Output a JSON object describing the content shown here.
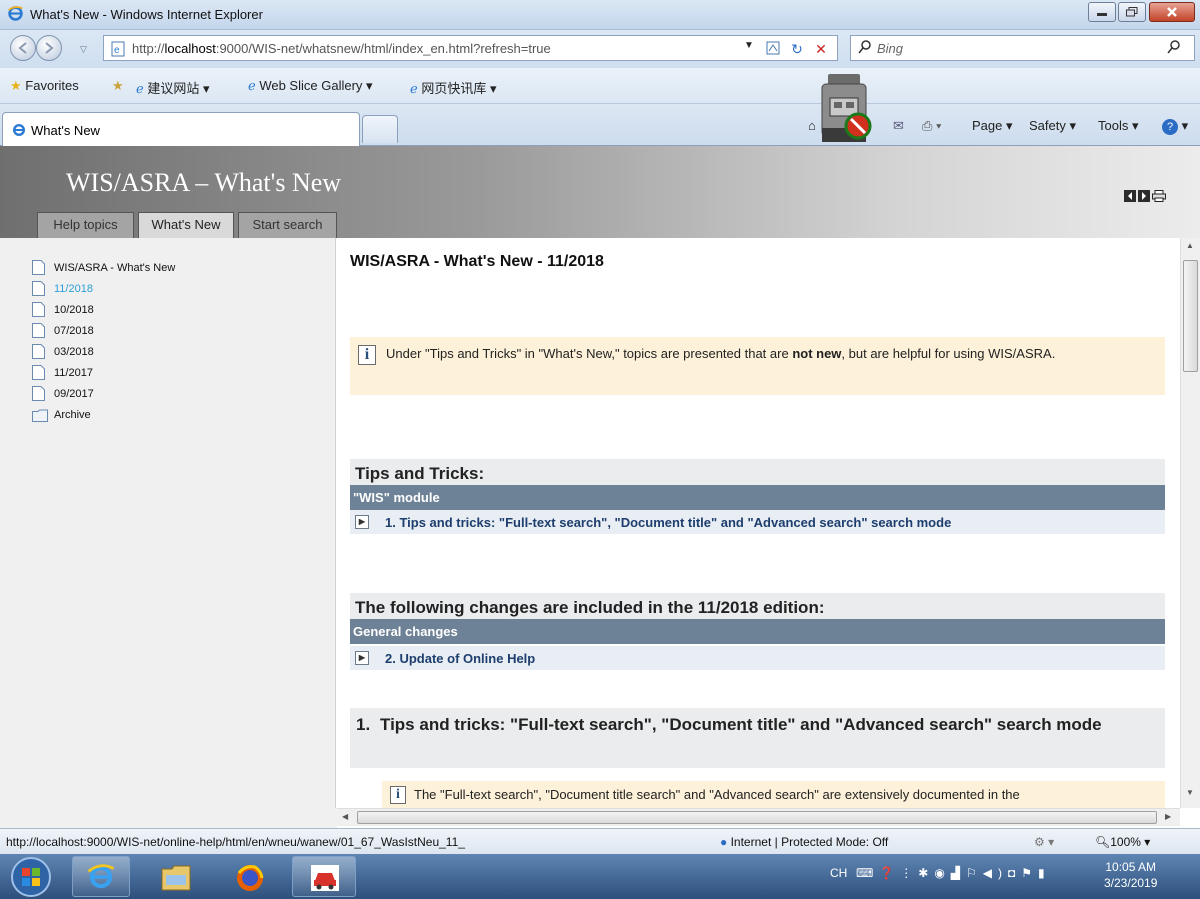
{
  "window": {
    "title": "What's New - Windows Internet Explorer"
  },
  "address": {
    "url_prefix": "http://",
    "url_host": "localhost",
    "url_rest": ":9000/WIS-net/whatsnew/html/index_en.html?refresh=true"
  },
  "search": {
    "placeholder": "Bing"
  },
  "favorites": {
    "label": "Favorites",
    "items": [
      "建议网站 ▾",
      "Web Slice Gallery ▾",
      "网页快讯库 ▾"
    ]
  },
  "tab": {
    "label": "What's New"
  },
  "toolbar": {
    "page": "Page ▾",
    "safety": "Safety ▾",
    "tools": "Tools ▾"
  },
  "app": {
    "title": "WIS/ASRA – What's New",
    "tabs": [
      "Help topics",
      "What's New",
      "Start search"
    ]
  },
  "tree": [
    {
      "label": "WIS/ASRA - What's New",
      "type": "doc"
    },
    {
      "label": "11/2018",
      "type": "doc",
      "selected": true
    },
    {
      "label": "10/2018",
      "type": "doc"
    },
    {
      "label": "07/2018",
      "type": "doc"
    },
    {
      "label": "03/2018",
      "type": "doc"
    },
    {
      "label": "11/2017",
      "type": "doc"
    },
    {
      "label": "09/2017",
      "type": "doc"
    },
    {
      "label": "Archive",
      "type": "folder"
    }
  ],
  "content": {
    "heading": "WIS/ASRA - What's New - 11/2018",
    "note1_a": "Under \"Tips and Tricks\" in \"What's New,\" topics are presented that are ",
    "note1_b": "not new",
    "note1_c": ", but are helpful for using WIS/ASRA.",
    "tips_title": "Tips and Tricks:",
    "tips_bar": "\"WIS\" module",
    "tips_link": "1. Tips and tricks: \"Full-text search\", \"Document title\" and \"Advanced search\" search mode",
    "changes_title": "The following changes are included in the 11/2018 edition:",
    "changes_bar": "General changes",
    "changes_link": "2. Update of Online Help",
    "sec_num": "1.",
    "sec_title": "Tips and tricks: \"Full-text search\", \"Document title\" and \"Advanced search\" search mode",
    "note2": "The \"Full-text search\", \"Document title search\" and \"Advanced search\" are extensively documented in the"
  },
  "status": {
    "link": "http://localhost:9000/WIS-net/online-help/html/en/wneu/wanew/01_67_WasIstNeu_11_",
    "zone": "Internet | Protected Mode: Off",
    "zoom": "100%"
  },
  "clock": {
    "time": "10:05 AM",
    "date": "3/23/2019"
  },
  "tray": {
    "lang": "CH"
  }
}
